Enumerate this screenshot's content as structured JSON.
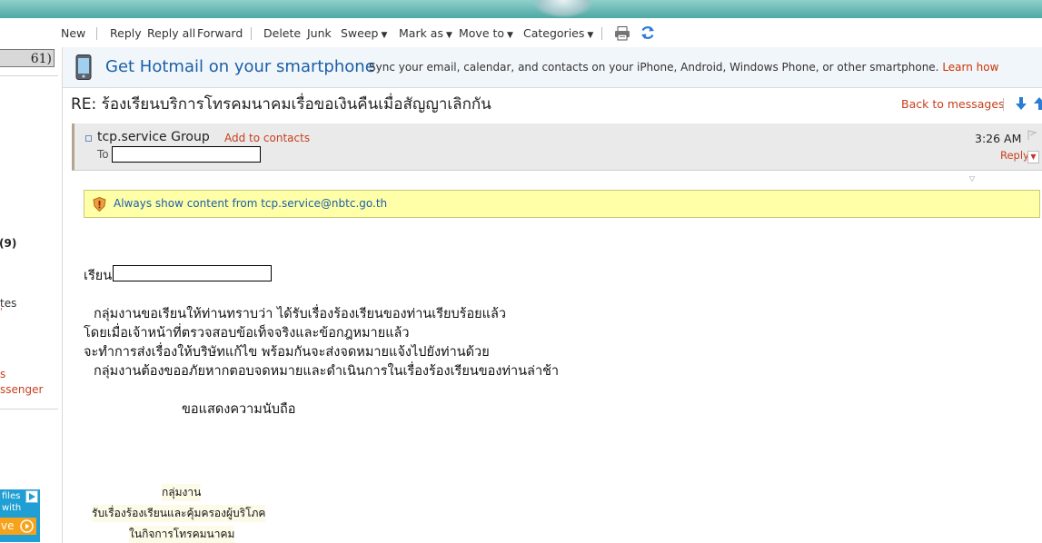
{
  "toolbar": {
    "new": "New",
    "reply": "Reply",
    "reply_all": "Reply all",
    "forward": "Forward",
    "delete": "Delete",
    "junk": "Junk",
    "sweep": "Sweep",
    "mark_as": "Mark as",
    "move_to": "Move to",
    "categories": "Categories"
  },
  "sidebar": {
    "inbox_count": "61)",
    "folder_count": "(9)",
    "item_tes": "tes",
    "item_s": "s",
    "item_messenger": "ssenger",
    "ad_line1": "files",
    "ad_line2": "with",
    "ad_line3": "ve"
  },
  "promo": {
    "title": "Get Hotmail on your smartphone",
    "description": "Sync your email, calendar, and contacts on your iPhone, Android, Windows Phone, or other smartphone.",
    "link": "Learn how"
  },
  "message": {
    "subject": "RE: ร้องเรียนบริการโทรคมนาคมเรื่อขอเงินคืนเมื่อสัญญาเลิกกัน",
    "back_link": "Back to messages",
    "sender": "tcp.service Group",
    "add_contacts": "Add to contacts",
    "to_label": "To",
    "time": "3:26 AM",
    "reply": "Reply",
    "safety_notice": "Always show content from tcp.service@nbtc.go.th",
    "greeting": "เรียน",
    "body_line1": "กลุ่มงานขอเรียนให้ท่านทราบว่า ได้รับเรื่องร้องเรียนของท่านเรียบร้อยแล้ว",
    "body_line2": "โดยเมื่อเจ้าหน้าที่ตรวจสอบข้อเท็จจริงและข้อกฎหมายแล้ว",
    "body_line3": "จะทำการส่งเรื่องให้บริษัทแก้ไข พร้อมกันจะส่งจดหมายแจ้งไปยังท่านด้วย",
    "body_line4": "กลุ่มงานต้องขออภัยหากตอบจดหมายและดำเนินการในเรื่องร้องเรียนของท่านล่าช้า",
    "closing": "ขอแสดงความนับถือ",
    "sig_line1": "กลุ่มงาน",
    "sig_line2": "รับเรื่องร้องเรียนและคุ้มครองผู้บริโภค",
    "sig_line3": "ในกิจการโทรคมนาคม"
  },
  "colors": {
    "link_red": "#c8401e",
    "link_blue": "#1a5fa8",
    "notice_yellow": "#ffffa8"
  }
}
